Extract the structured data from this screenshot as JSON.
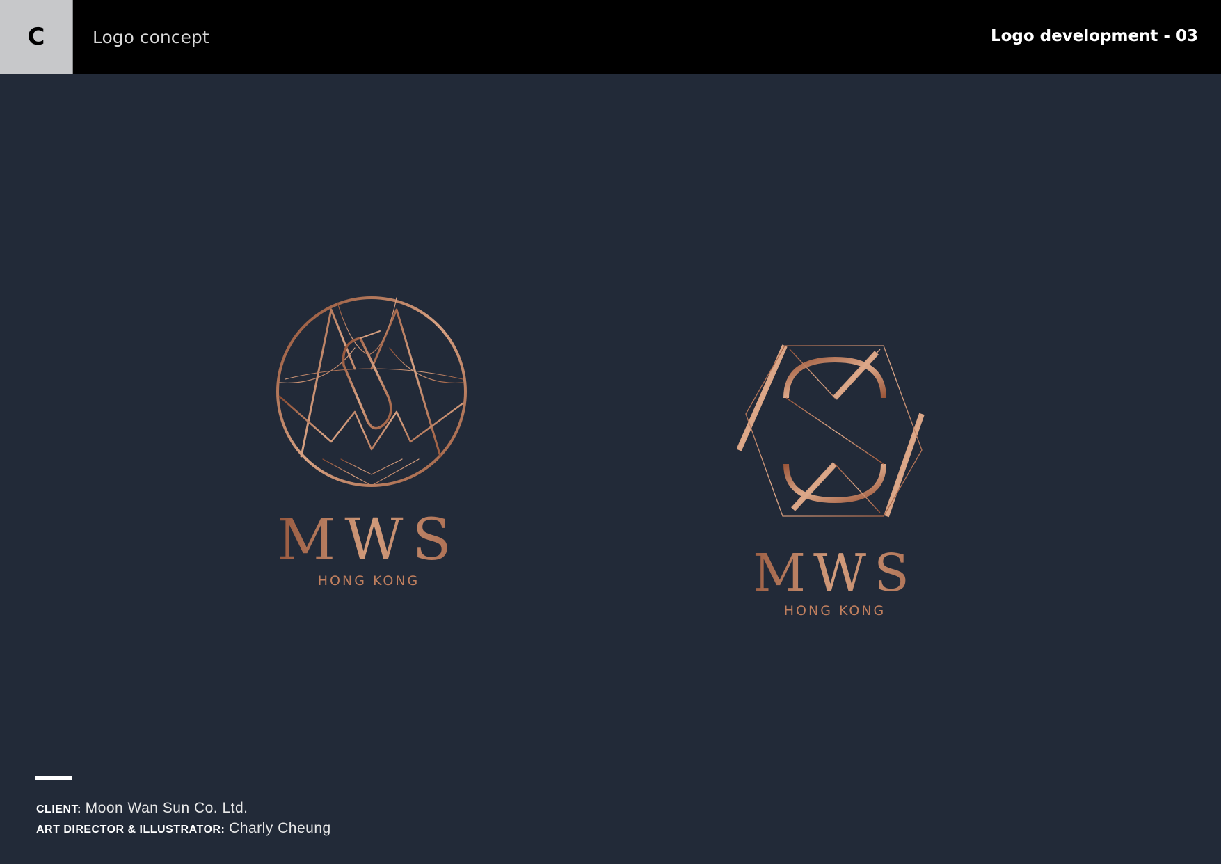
{
  "header": {
    "badge": "C",
    "title": "Logo concept",
    "page_label": "Logo development - 03"
  },
  "logos": [
    {
      "name": "MWS",
      "subtitle": "HONG KONG",
      "style": "circle-monogram",
      "color": "#b97a5a"
    },
    {
      "name": "MWS",
      "subtitle": "HONG KONG",
      "style": "hexagon-monogram",
      "color": "#b97a5a"
    }
  ],
  "credits": {
    "client_label": "CLIENT:",
    "client_value": "Moon Wan Sun Co. Ltd.",
    "director_label": "ART DIRECTOR & ILLUSTRATOR:",
    "director_value": "Charly Cheung"
  },
  "colors": {
    "background": "#222a38",
    "header_bar": "#000000",
    "badge": "#c7c8ca",
    "copper": "#b97a5a"
  }
}
